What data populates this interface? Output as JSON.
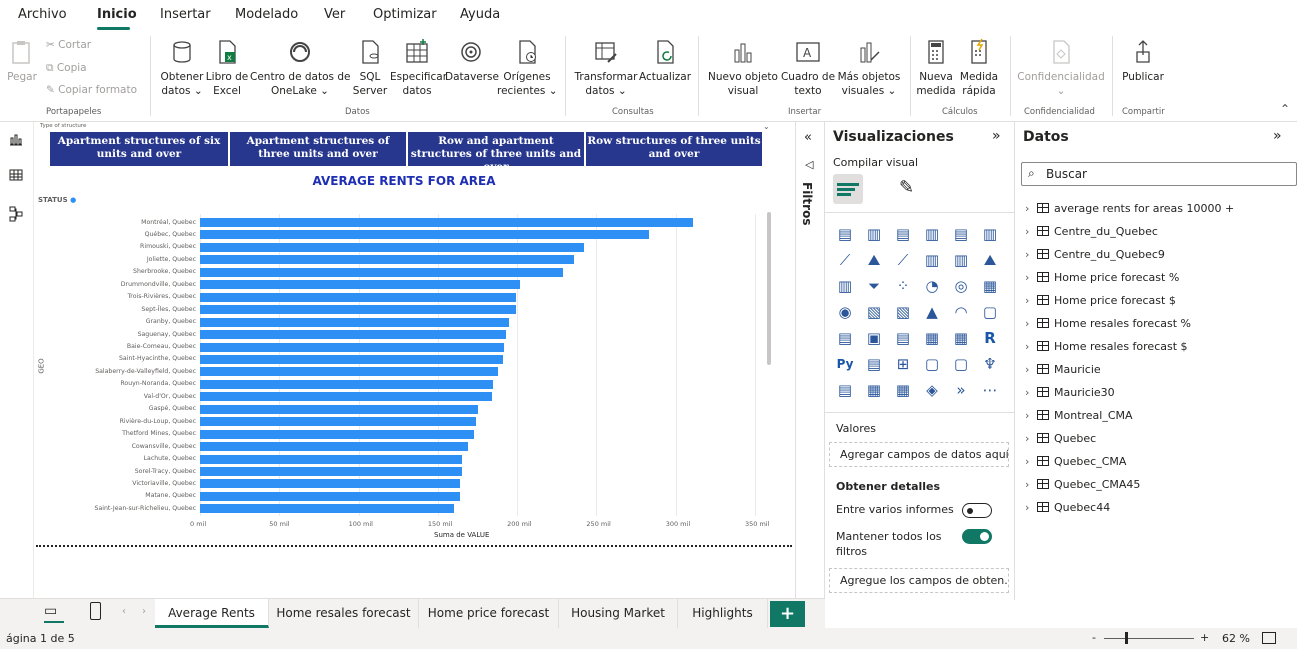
{
  "menu": [
    "Archivo",
    "Inicio",
    "Insertar",
    "Modelado",
    "Ver",
    "Optimizar",
    "Ayuda"
  ],
  "ribbon": {
    "clipboard": {
      "paste": "Pegar",
      "cut": "Cortar",
      "copy": "Copia",
      "format": "Copiar formato",
      "group": "Portapapeles"
    },
    "data": {
      "get": [
        "Obtener",
        "datos ⌄"
      ],
      "excel": [
        "Libro de",
        "Excel"
      ],
      "onelake": [
        "Centro de datos de",
        "OneLake ⌄"
      ],
      "sql": [
        "SQL",
        "Server"
      ],
      "enter": [
        "Especificar",
        "datos"
      ],
      "dataverse": "Dataverse",
      "recent": [
        "Orígenes",
        "recientes ⌄"
      ],
      "group": "Datos"
    },
    "queries": {
      "transform": [
        "Transformar",
        "datos ⌄"
      ],
      "refresh": "Actualizar",
      "group": "Consultas"
    },
    "insert": {
      "newvisual": [
        "Nuevo objeto",
        "visual"
      ],
      "textbox": [
        "Cuadro de",
        "texto"
      ],
      "more": [
        "Más objetos",
        "visuales ⌄"
      ],
      "group": "Insertar"
    },
    "calc": {
      "newmeasure": [
        "Nueva",
        "medida"
      ],
      "quick": [
        "Medida",
        "rápida"
      ],
      "group": "Cálculos"
    },
    "sensitivity": {
      "label": "Confidencialidad",
      "group": "Confidencialidad"
    },
    "share": {
      "publish": "Publicar",
      "group": "Compartir"
    }
  },
  "slicer": {
    "caption": "Type of structure",
    "buttons": [
      "Apartment structures of six units and over",
      "Apartment structures of three units and over",
      "Row and apartment structures of three units and over",
      "Row structures of three units and over"
    ]
  },
  "chart_data": {
    "type": "bar",
    "title": "AVERAGE RENTS FOR AREA",
    "legend_title": "STATUS",
    "ylabel": "GEO",
    "xlabel": "Suma de VALUE",
    "xticks": [
      "0 mil",
      "50 mil",
      "100 mil",
      "150 mil",
      "200 mil",
      "250 mil",
      "300 mil",
      "350 mil"
    ],
    "xlim": [
      0,
      350000
    ],
    "color": "#2e8ff5",
    "categories": [
      "Montréal, Quebec",
      "Québec, Quebec",
      "Rimouski, Quebec",
      "Joliette, Quebec",
      "Sherbrooke, Quebec",
      "Drummondville, Quebec",
      "Trois-Rivières, Quebec",
      "Sept-Îles, Quebec",
      "Granby, Quebec",
      "Saguenay, Quebec",
      "Baie-Comeau, Quebec",
      "Saint-Hyacinthe, Quebec",
      "Salaberry-de-Valleyfield, Quebec",
      "Rouyn-Noranda, Quebec",
      "Val-d'Or, Quebec",
      "Gaspé, Quebec",
      "Rivière-du-Loup, Quebec",
      "Thetford Mines, Quebec",
      "Cowansville, Quebec",
      "Lachute, Quebec",
      "Sorel-Tracy, Quebec",
      "Victoriaville, Quebec",
      "Matane, Quebec",
      "Saint-Jean-sur-Richelieu, Quebec"
    ],
    "values": [
      311000,
      283000,
      242000,
      236000,
      229000,
      202000,
      199000,
      199000,
      195000,
      193000,
      192000,
      191000,
      188000,
      185000,
      184000,
      175000,
      174000,
      173000,
      169000,
      165000,
      165000,
      164000,
      164000,
      160000
    ]
  },
  "filters_label": "Filtros",
  "viz_panel": {
    "title": "Visualizaciones",
    "build": "Compilar visual",
    "values": "Valores",
    "add_fields": "Agregar campos de datos aquí",
    "details": "Obtener detalles",
    "cross_report": "Entre varios informes",
    "keep_filters": "Mantener todos los filtros",
    "add_drill": "Agregue los campos de obten..."
  },
  "data_panel": {
    "title": "Datos",
    "search_placeholder": "Buscar",
    "tables": [
      "average rents for areas 10000 +",
      "Centre_du_Quebec",
      "Centre_du_Quebec9",
      "Home price forecast %",
      "Home price forecast $",
      "Home resales forecast %",
      "Home resales forecast $",
      "Mauricie",
      "Mauricie30",
      "Montreal_CMA",
      "Quebec",
      "Quebec_CMA",
      "Quebec_CMA45",
      "Quebec44"
    ]
  },
  "tabs": [
    "Average Rents",
    "Home resales forecast",
    "Home price forecast",
    "Housing Market",
    "Highlights"
  ],
  "status": {
    "page": "ágina 1 de 5",
    "zoom": "62 %"
  },
  "colors": {
    "accent": "#117865",
    "slicer": "#27378e",
    "title": "#1f2fb4"
  }
}
